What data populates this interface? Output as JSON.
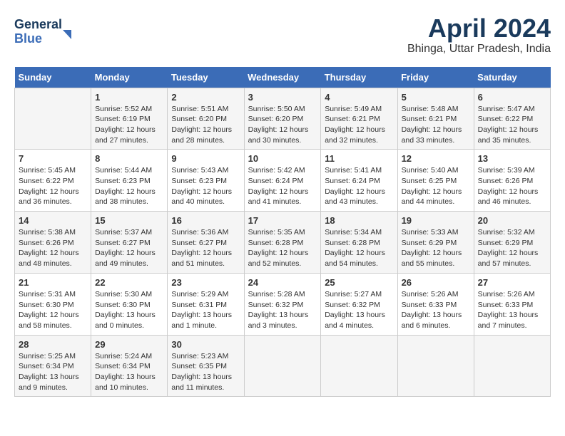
{
  "header": {
    "logo_line1": "General",
    "logo_line2": "Blue",
    "month_year": "April 2024",
    "location": "Bhinga, Uttar Pradesh, India"
  },
  "days_of_week": [
    "Sunday",
    "Monday",
    "Tuesday",
    "Wednesday",
    "Thursday",
    "Friday",
    "Saturday"
  ],
  "weeks": [
    [
      {
        "day": "",
        "info": ""
      },
      {
        "day": "1",
        "info": "Sunrise: 5:52 AM\nSunset: 6:19 PM\nDaylight: 12 hours\nand 27 minutes."
      },
      {
        "day": "2",
        "info": "Sunrise: 5:51 AM\nSunset: 6:20 PM\nDaylight: 12 hours\nand 28 minutes."
      },
      {
        "day": "3",
        "info": "Sunrise: 5:50 AM\nSunset: 6:20 PM\nDaylight: 12 hours\nand 30 minutes."
      },
      {
        "day": "4",
        "info": "Sunrise: 5:49 AM\nSunset: 6:21 PM\nDaylight: 12 hours\nand 32 minutes."
      },
      {
        "day": "5",
        "info": "Sunrise: 5:48 AM\nSunset: 6:21 PM\nDaylight: 12 hours\nand 33 minutes."
      },
      {
        "day": "6",
        "info": "Sunrise: 5:47 AM\nSunset: 6:22 PM\nDaylight: 12 hours\nand 35 minutes."
      }
    ],
    [
      {
        "day": "7",
        "info": "Sunrise: 5:45 AM\nSunset: 6:22 PM\nDaylight: 12 hours\nand 36 minutes."
      },
      {
        "day": "8",
        "info": "Sunrise: 5:44 AM\nSunset: 6:23 PM\nDaylight: 12 hours\nand 38 minutes."
      },
      {
        "day": "9",
        "info": "Sunrise: 5:43 AM\nSunset: 6:23 PM\nDaylight: 12 hours\nand 40 minutes."
      },
      {
        "day": "10",
        "info": "Sunrise: 5:42 AM\nSunset: 6:24 PM\nDaylight: 12 hours\nand 41 minutes."
      },
      {
        "day": "11",
        "info": "Sunrise: 5:41 AM\nSunset: 6:24 PM\nDaylight: 12 hours\nand 43 minutes."
      },
      {
        "day": "12",
        "info": "Sunrise: 5:40 AM\nSunset: 6:25 PM\nDaylight: 12 hours\nand 44 minutes."
      },
      {
        "day": "13",
        "info": "Sunrise: 5:39 AM\nSunset: 6:26 PM\nDaylight: 12 hours\nand 46 minutes."
      }
    ],
    [
      {
        "day": "14",
        "info": "Sunrise: 5:38 AM\nSunset: 6:26 PM\nDaylight: 12 hours\nand 48 minutes."
      },
      {
        "day": "15",
        "info": "Sunrise: 5:37 AM\nSunset: 6:27 PM\nDaylight: 12 hours\nand 49 minutes."
      },
      {
        "day": "16",
        "info": "Sunrise: 5:36 AM\nSunset: 6:27 PM\nDaylight: 12 hours\nand 51 minutes."
      },
      {
        "day": "17",
        "info": "Sunrise: 5:35 AM\nSunset: 6:28 PM\nDaylight: 12 hours\nand 52 minutes."
      },
      {
        "day": "18",
        "info": "Sunrise: 5:34 AM\nSunset: 6:28 PM\nDaylight: 12 hours\nand 54 minutes."
      },
      {
        "day": "19",
        "info": "Sunrise: 5:33 AM\nSunset: 6:29 PM\nDaylight: 12 hours\nand 55 minutes."
      },
      {
        "day": "20",
        "info": "Sunrise: 5:32 AM\nSunset: 6:29 PM\nDaylight: 12 hours\nand 57 minutes."
      }
    ],
    [
      {
        "day": "21",
        "info": "Sunrise: 5:31 AM\nSunset: 6:30 PM\nDaylight: 12 hours\nand 58 minutes."
      },
      {
        "day": "22",
        "info": "Sunrise: 5:30 AM\nSunset: 6:30 PM\nDaylight: 13 hours\nand 0 minutes."
      },
      {
        "day": "23",
        "info": "Sunrise: 5:29 AM\nSunset: 6:31 PM\nDaylight: 13 hours\nand 1 minute."
      },
      {
        "day": "24",
        "info": "Sunrise: 5:28 AM\nSunset: 6:32 PM\nDaylight: 13 hours\nand 3 minutes."
      },
      {
        "day": "25",
        "info": "Sunrise: 5:27 AM\nSunset: 6:32 PM\nDaylight: 13 hours\nand 4 minutes."
      },
      {
        "day": "26",
        "info": "Sunrise: 5:26 AM\nSunset: 6:33 PM\nDaylight: 13 hours\nand 6 minutes."
      },
      {
        "day": "27",
        "info": "Sunrise: 5:26 AM\nSunset: 6:33 PM\nDaylight: 13 hours\nand 7 minutes."
      }
    ],
    [
      {
        "day": "28",
        "info": "Sunrise: 5:25 AM\nSunset: 6:34 PM\nDaylight: 13 hours\nand 9 minutes."
      },
      {
        "day": "29",
        "info": "Sunrise: 5:24 AM\nSunset: 6:34 PM\nDaylight: 13 hours\nand 10 minutes."
      },
      {
        "day": "30",
        "info": "Sunrise: 5:23 AM\nSunset: 6:35 PM\nDaylight: 13 hours\nand 11 minutes."
      },
      {
        "day": "",
        "info": ""
      },
      {
        "day": "",
        "info": ""
      },
      {
        "day": "",
        "info": ""
      },
      {
        "day": "",
        "info": ""
      }
    ]
  ]
}
